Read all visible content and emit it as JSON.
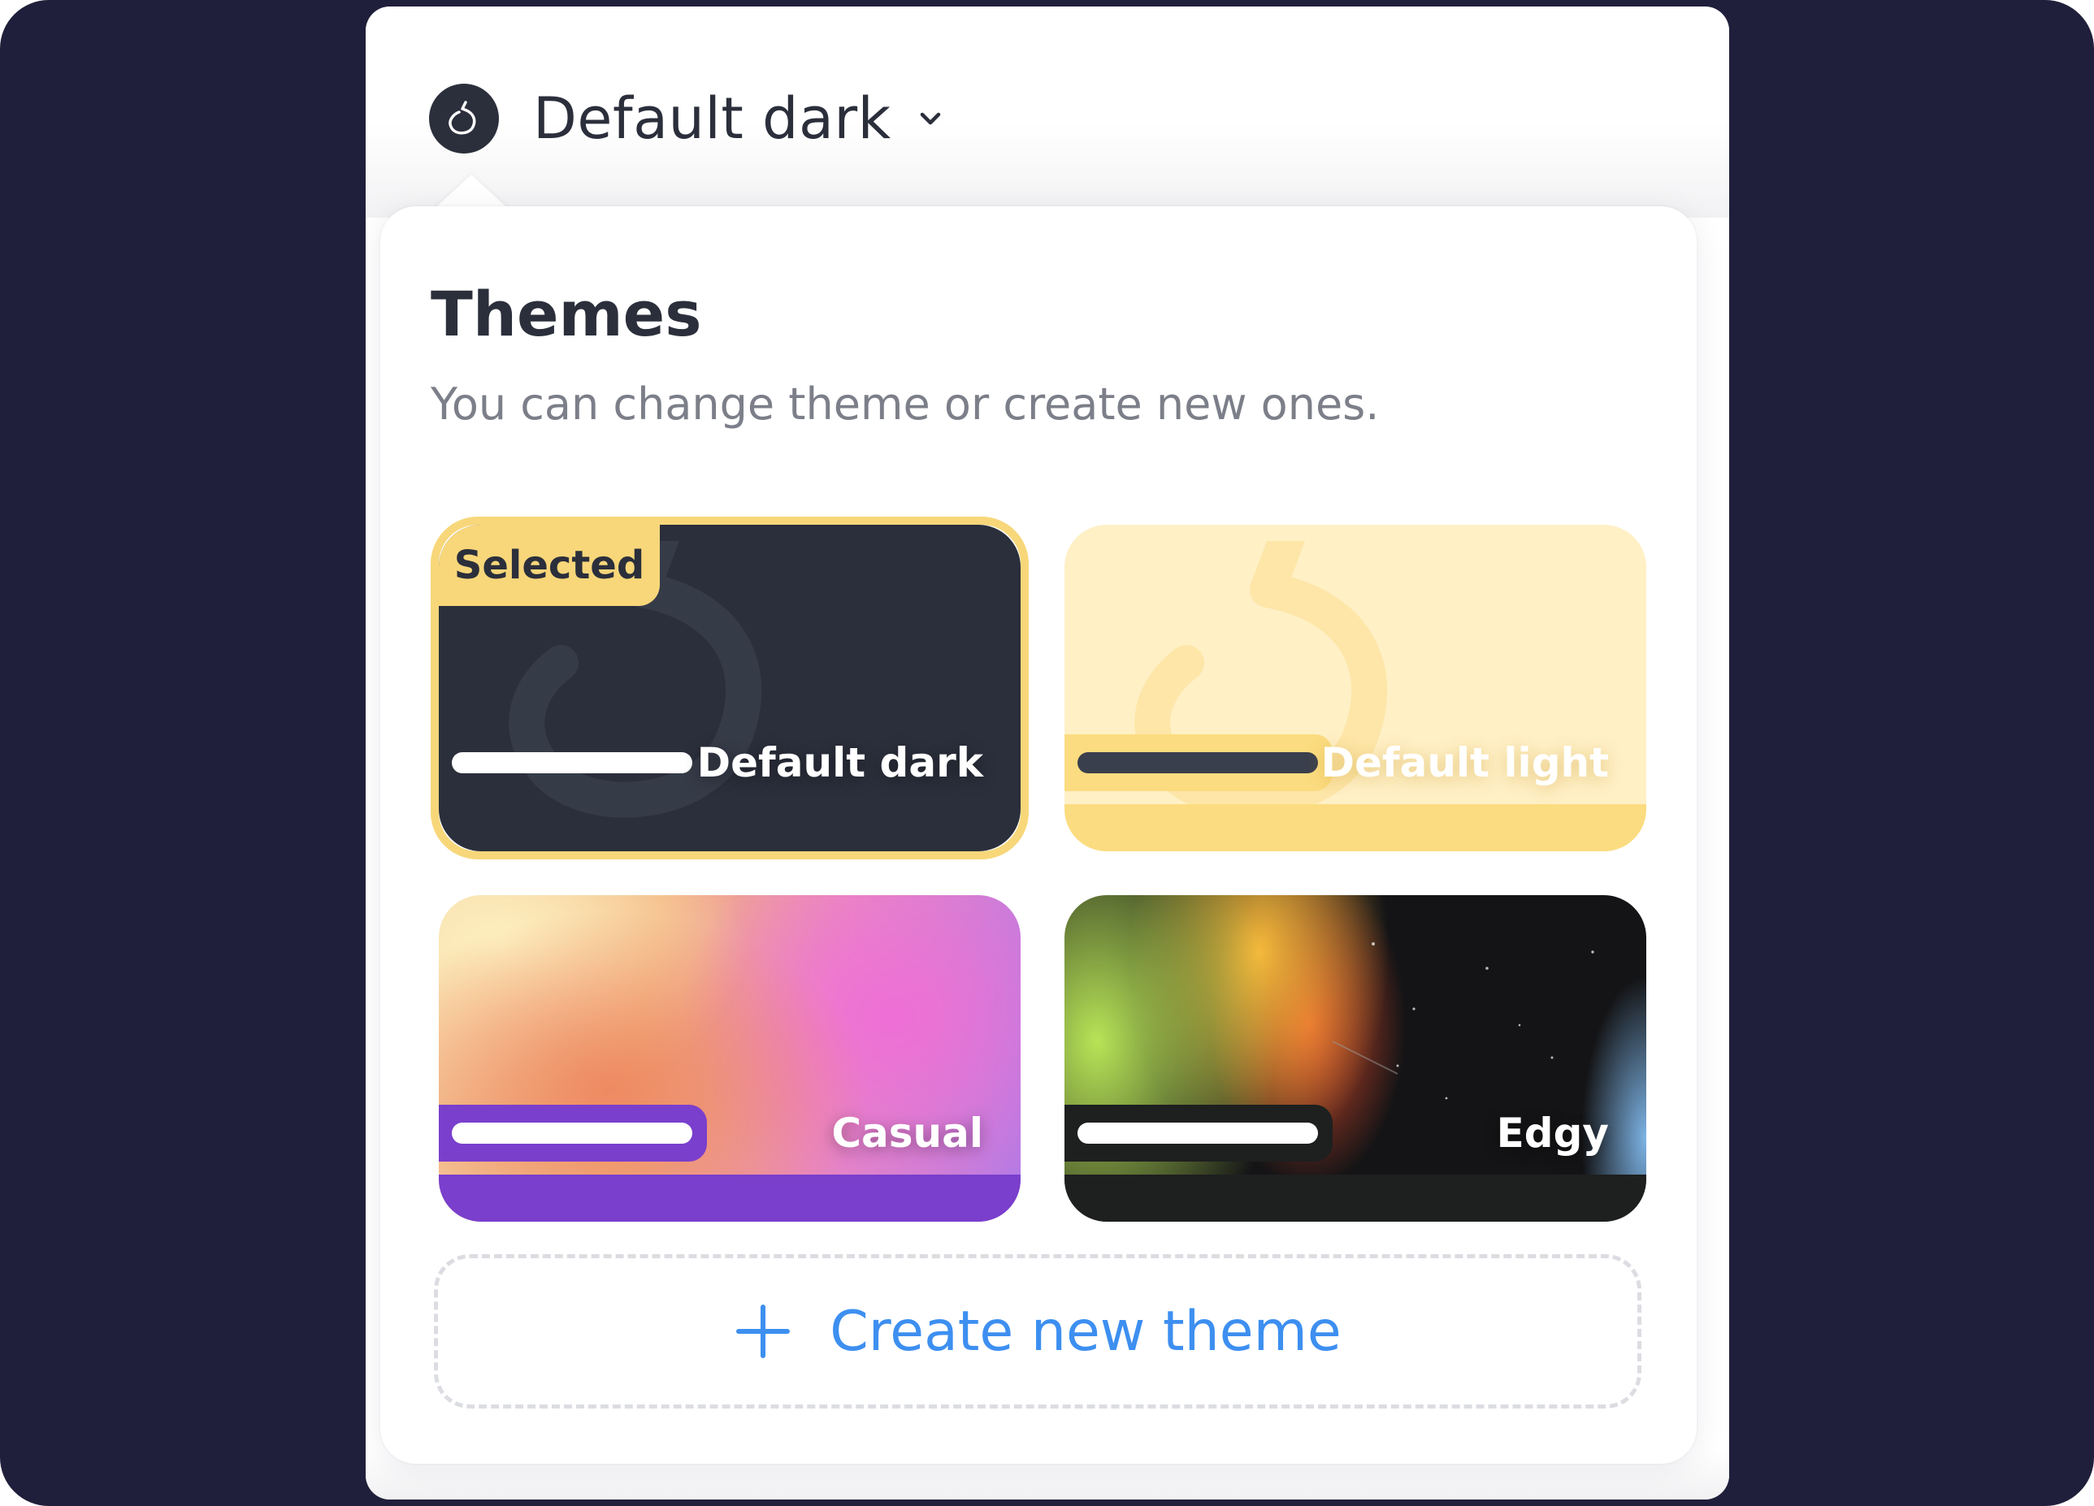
{
  "header": {
    "selected_theme": "Default dark"
  },
  "popover": {
    "title": "Themes",
    "subtitle": "You can change theme or create new ones.",
    "selected_badge": "Selected",
    "themes": [
      {
        "label": "Default dark",
        "selected": true
      },
      {
        "label": "Default light",
        "selected": false
      },
      {
        "label": "Casual",
        "selected": false
      },
      {
        "label": "Edgy",
        "selected": false
      }
    ],
    "create_label": "Create new theme"
  },
  "colors": {
    "background": "#201f3b",
    "panel": "#ffffff",
    "text_dark": "#2b2f3b",
    "text_muted": "#7c7f89",
    "accent_yellow": "#f8d77a",
    "accent_blue": "#3d8ff0",
    "casual_purple": "#7a3fcc"
  },
  "icons": {
    "avatar": "pear-logo-icon",
    "dropdown": "chevron-down-icon",
    "create": "plus-icon"
  }
}
